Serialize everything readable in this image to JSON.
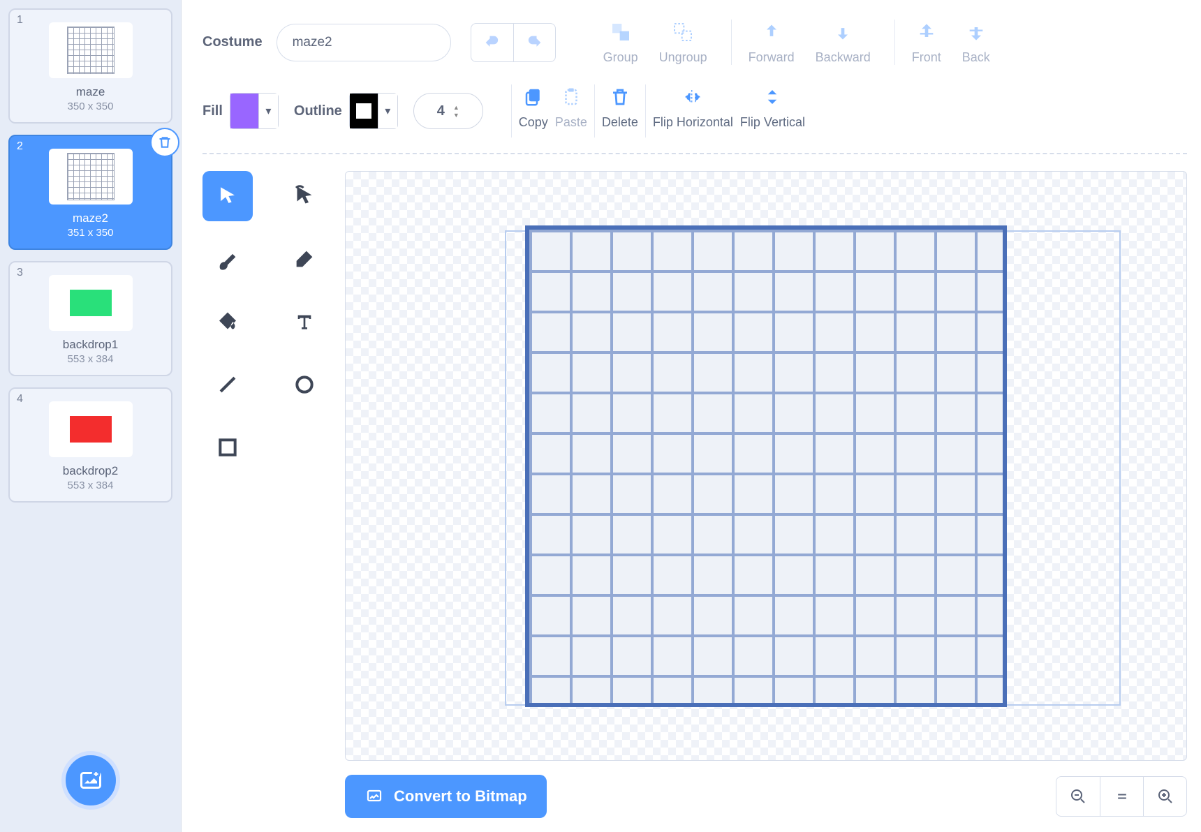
{
  "costumes": [
    {
      "num": "1",
      "name": "maze",
      "dims": "350 x 350",
      "type": "maze"
    },
    {
      "num": "2",
      "name": "maze2",
      "dims": "351 x 350",
      "type": "maze",
      "selected": true
    },
    {
      "num": "3",
      "name": "backdrop1",
      "dims": "553 x 384",
      "type": "green"
    },
    {
      "num": "4",
      "name": "backdrop2",
      "dims": "553 x 384",
      "type": "red"
    }
  ],
  "costume_label": "Costume",
  "costume_name": "maze2",
  "fill_label": "Fill",
  "outline_label": "Outline",
  "outline_width": "4",
  "top": {
    "group": "Group",
    "ungroup": "Ungroup",
    "forward": "Forward",
    "backward": "Backward",
    "front": "Front",
    "back": "Back"
  },
  "row2": {
    "copy": "Copy",
    "paste": "Paste",
    "delete": "Delete",
    "fliph": "Flip Horizontal",
    "flipv": "Flip Vertical"
  },
  "convert": "Convert to Bitmap",
  "tools": {
    "select": "select",
    "reshape": "reshape",
    "brush": "brush",
    "erase": "erase",
    "fill": "fill",
    "text": "text",
    "line": "line",
    "circle": "circle",
    "rect": "rect"
  }
}
